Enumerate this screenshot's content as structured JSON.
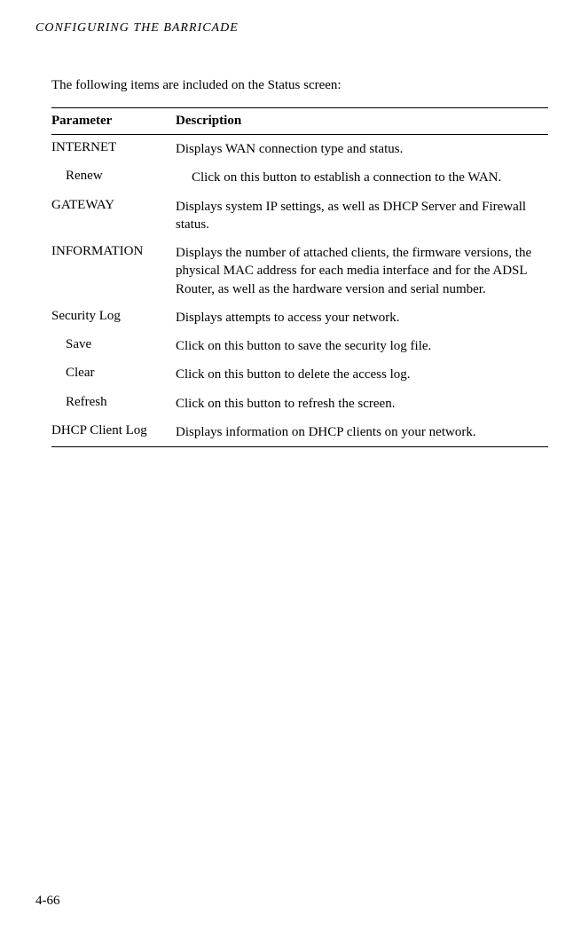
{
  "header": {
    "title": "CONFIGURING THE BARRICADE"
  },
  "intro": "The following items are included on the Status screen:",
  "tableHeaders": {
    "parameter": "Parameter",
    "description": "Description"
  },
  "rows": [
    {
      "param": "INTERNET",
      "desc": "Displays WAN connection type and status.",
      "indent": false,
      "descIndent": false
    },
    {
      "param": "Renew",
      "desc": "Click on this button to establish a connection to the WAN.",
      "indent": true,
      "descIndent": true
    },
    {
      "param": "GATEWAY",
      "desc": "Displays system IP settings, as well as DHCP Server and Firewall status.",
      "indent": false,
      "descIndent": false
    },
    {
      "param": "INFORMATION",
      "desc": "Displays the number of attached clients, the firmware versions, the physical MAC address for each media interface and for the ADSL Router, as well as the hardware version and serial number.",
      "indent": false,
      "descIndent": false
    },
    {
      "param": "Security Log",
      "desc": "Displays attempts to access your network.",
      "indent": false,
      "descIndent": false
    },
    {
      "param": "Save",
      "desc": "Click on this button to save the security log file.",
      "indent": true,
      "descIndent": false
    },
    {
      "param": "Clear",
      "desc": "Click on this button to delete the access log.",
      "indent": true,
      "descIndent": false
    },
    {
      "param": "Refresh",
      "desc": "Click on this button to refresh the screen.",
      "indent": true,
      "descIndent": false
    },
    {
      "param": "DHCP Client Log",
      "desc": "Displays information on DHCP clients on your network.",
      "indent": false,
      "descIndent": false
    }
  ],
  "pageNumber": "4-66"
}
